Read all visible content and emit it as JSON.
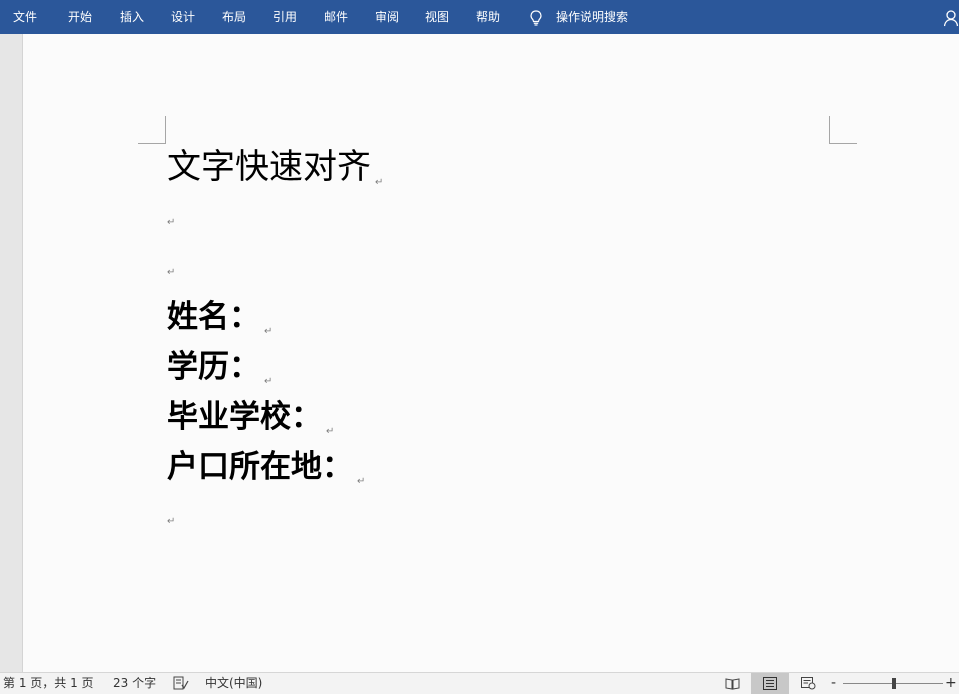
{
  "ribbon": {
    "tabs": [
      "文件",
      "开始",
      "插入",
      "设计",
      "布局",
      "引用",
      "邮件",
      "审阅",
      "视图",
      "帮助"
    ],
    "search_label": "操作说明搜索",
    "color": "#2b579a"
  },
  "document": {
    "title": "文字快速对齐",
    "fields": [
      "姓名：",
      "学历：",
      "毕业学校：",
      "户口所在地："
    ],
    "paragraph_mark": "↵"
  },
  "status_bar": {
    "page_info": "第 1 页，共 1 页",
    "word_count": "23 个字",
    "language": "中文(中国)",
    "zoom_out": "-",
    "zoom_in": "+"
  },
  "icons": {
    "tell_me": "lightbulb-icon",
    "account": "account-icon",
    "proofing": "proofing-icon",
    "read_mode": "read-mode-icon",
    "print_layout": "print-layout-icon",
    "web_layout": "web-layout-icon"
  }
}
